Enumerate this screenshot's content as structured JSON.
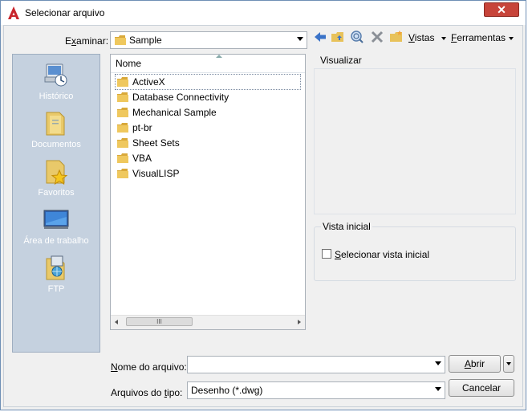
{
  "window": {
    "title": "Selecionar arquivo",
    "close_label": "✕"
  },
  "lookin": {
    "label_pre": "E",
    "label_u": "x",
    "label_post": "aminar:",
    "value": "Sample"
  },
  "toolbar": {
    "views_u": "V",
    "views_rest": "istas",
    "tools_u": "F",
    "tools_rest": "erramentas"
  },
  "places": [
    {
      "label": "Histórico",
      "icon": "history-icon"
    },
    {
      "label": "Documentos",
      "icon": "documents-icon"
    },
    {
      "label": "Favoritos",
      "icon": "favorites-icon"
    },
    {
      "label": "Área de trabalho",
      "icon": "desktop-icon"
    },
    {
      "label": "FTP",
      "icon": "ftp-icon"
    }
  ],
  "filelist": {
    "column_name": "Nome",
    "items": [
      "ActiveX",
      "Database Connectivity",
      "Mechanical Sample",
      "pt-br",
      "Sheet Sets",
      "VBA",
      "VisualLISP"
    ],
    "scroll_grip": "III"
  },
  "preview": {
    "title": "Visualizar"
  },
  "initial_view": {
    "title": "Vista inicial",
    "checkbox_u": "S",
    "checkbox_rest": "elecionar vista inicial",
    "checked": false
  },
  "filename": {
    "label_pre": "",
    "label_u": "N",
    "label_post": "ome do arquivo:",
    "value": ""
  },
  "filetype": {
    "label_pre": "Arquivos do ",
    "label_u": "t",
    "label_post": "ipo:",
    "value": "Desenho (*.dwg)"
  },
  "buttons": {
    "open_u": "A",
    "open_rest": "brir",
    "cancel": "Cancelar"
  },
  "colors": {
    "places_bg": "#c5d1df",
    "folder": "#e8c25a",
    "close": "#c7443a",
    "accent_arrow": "#3a73c8"
  }
}
